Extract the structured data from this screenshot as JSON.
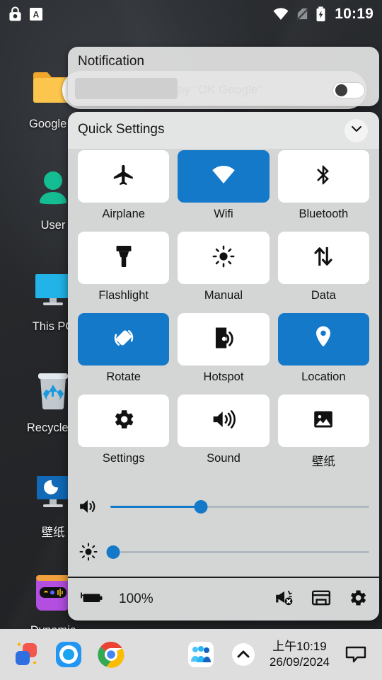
{
  "status_bar": {
    "left_icons": [
      {
        "name": "lock-icon",
        "label": "Screen lock"
      },
      {
        "name": "keyboard-input-icon",
        "label": "A"
      }
    ],
    "right_icons": [
      {
        "name": "wifi-icon",
        "label": "Wi-Fi connected"
      },
      {
        "name": "no-sim-icon",
        "label": "No SIM"
      },
      {
        "name": "battery-charging-icon",
        "label": "Charging"
      }
    ],
    "clock": "10:19"
  },
  "desktop": {
    "icons": [
      {
        "name": "google-drive-folder-icon",
        "label": "Google A"
      },
      {
        "name": "user-icon",
        "label": "User"
      },
      {
        "name": "this-pc-icon",
        "label": "This PC"
      },
      {
        "name": "recycle-bin-icon",
        "label": "Recycle B"
      },
      {
        "name": "wallpaper-icon",
        "label": "壁纸"
      },
      {
        "name": "dynamic-icon",
        "label": "Dynamic"
      }
    ],
    "search_widget": {
      "name": "google-search-widget",
      "placeholder": "Say \"OK Google\""
    }
  },
  "notification_panel": {
    "title": "Notification",
    "toggle_state": "off"
  },
  "quick_settings": {
    "title": "Quick Settings",
    "collapse_icon": "chevron-down-icon",
    "tiles": [
      {
        "label": "Airplane",
        "icon": "airplane-icon",
        "active": false
      },
      {
        "label": "Wifi",
        "icon": "wifi-icon",
        "active": true
      },
      {
        "label": "Bluetooth",
        "icon": "bluetooth-icon",
        "active": false
      },
      {
        "label": "Flashlight",
        "icon": "flashlight-icon",
        "active": false
      },
      {
        "label": "Manual",
        "icon": "brightness-icon",
        "active": false
      },
      {
        "label": "Data",
        "icon": "data-transfer-icon",
        "active": false
      },
      {
        "label": "Rotate",
        "icon": "auto-rotate-icon",
        "active": true
      },
      {
        "label": "Hotspot",
        "icon": "hotspot-icon",
        "active": false
      },
      {
        "label": "Location",
        "icon": "location-pin-icon",
        "active": true
      },
      {
        "label": "Settings",
        "icon": "gear-icon",
        "active": false
      },
      {
        "label": "Sound",
        "icon": "volume-icon",
        "active": false
      },
      {
        "label": "壁纸",
        "icon": "image-icon",
        "active": false
      }
    ],
    "sliders": [
      {
        "name": "volume-slider",
        "icon": "volume-icon",
        "value": 35
      },
      {
        "name": "brightness-slider",
        "icon": "brightness-icon",
        "value": 1
      }
    ],
    "footer": {
      "battery_icon": "battery-charging-icon",
      "battery_percent": "100%",
      "actions": [
        {
          "name": "announcement-off-icon",
          "label": "Announcements off"
        },
        {
          "name": "cast-window-icon",
          "label": "Cast"
        },
        {
          "name": "gear-icon",
          "label": "Settings"
        }
      ]
    }
  },
  "taskbar": {
    "left_items": [
      {
        "name": "start-button",
        "label": "Start"
      },
      {
        "name": "app-circle-icon",
        "label": "Search"
      },
      {
        "name": "chrome-icon",
        "label": "Chrome"
      }
    ],
    "right_items": [
      {
        "name": "contacts-icon",
        "label": "Contacts"
      },
      {
        "name": "show-hidden-icons-button",
        "label": "Show hidden icons"
      }
    ],
    "clock": {
      "time": "上午10:19",
      "date": "26/09/2024"
    },
    "notification_center_icon": "speech-bubble-icon"
  },
  "colors": {
    "accent_blue": "#1479c9",
    "panel_gray": "#d4d6d6",
    "header_gray": "#e3e4e4",
    "taskbar_gray": "#dedede"
  }
}
